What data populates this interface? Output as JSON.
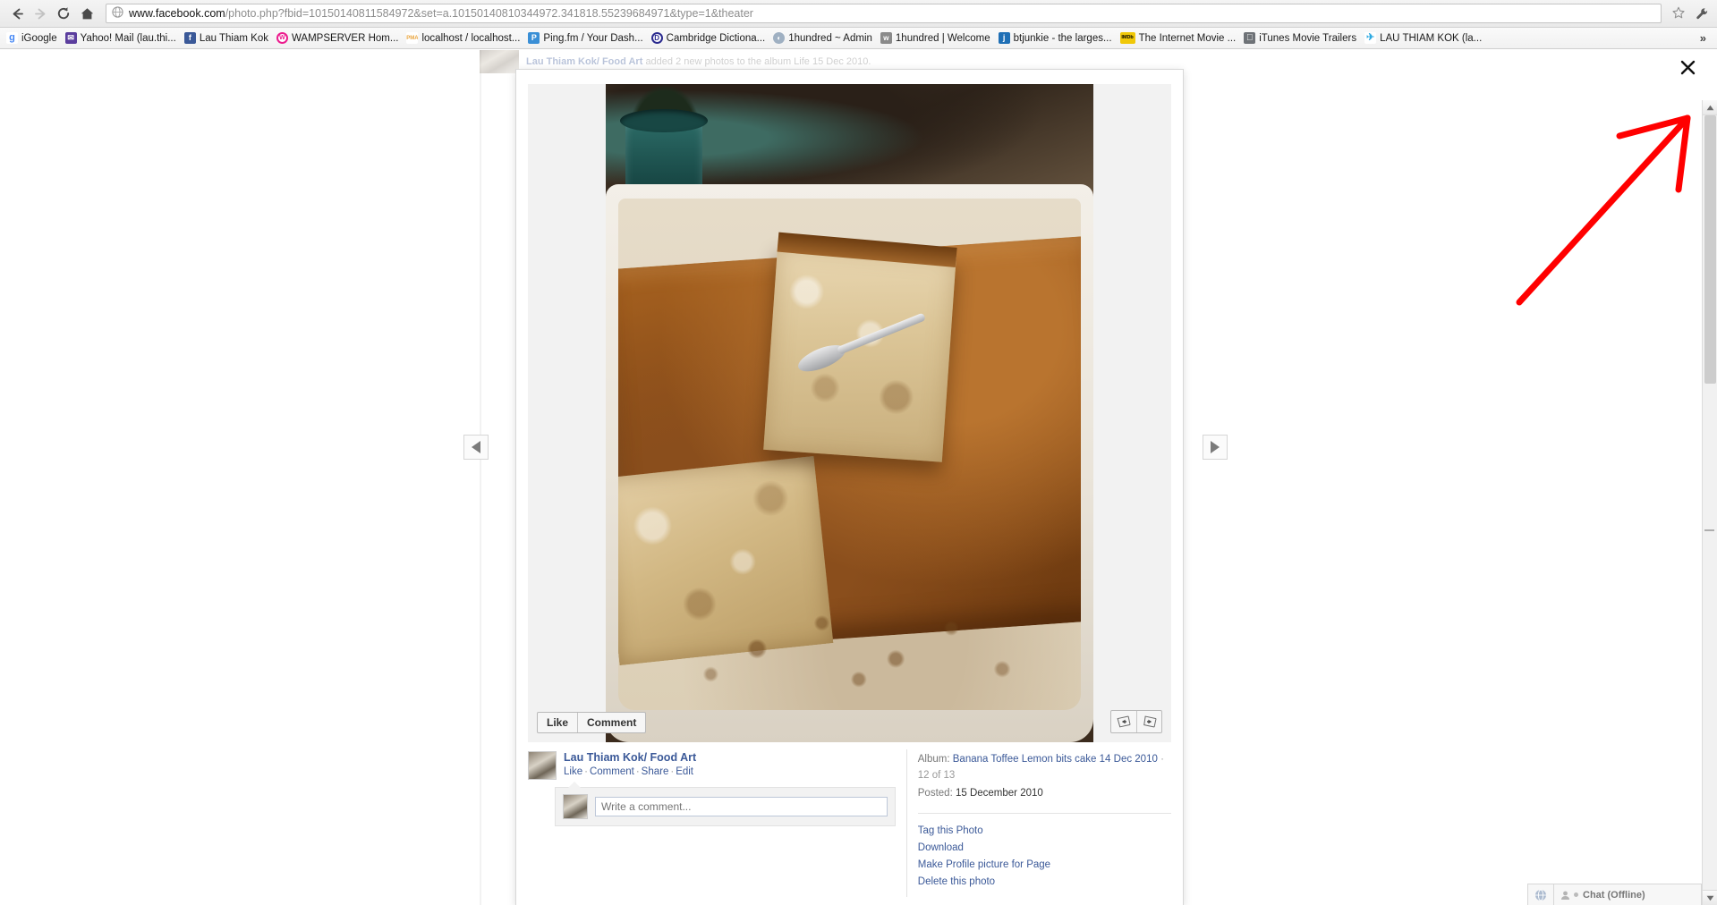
{
  "browser": {
    "back_icon": "back-arrow-icon",
    "forward_icon": "forward-arrow-icon",
    "reload_icon": "reload-icon",
    "home_icon": "home-icon",
    "url_host": "www.facebook.com",
    "url_path": "/photo.php?fbid=10150140811584972&set=a.10150140810344972.341818.55239684971&type=1&theater",
    "url_full": "www.facebook.com/photo.php?fbid=10150140811584972&set=a.10150140810344972.341818.55239684971&type=1&theater",
    "star_icon": "bookmark-star-icon",
    "wrench_icon": "wrench-menu-icon",
    "overflow_label": "»"
  },
  "bookmarks": [
    {
      "label": "iGoogle",
      "icon": "igoogle-favicon",
      "letter": "g",
      "bg": "#4285f4"
    },
    {
      "label": "Yahoo! Mail (lau.thi...",
      "icon": "yahoo-mail-favicon",
      "letter": "✉",
      "bg": "#5b3e9e"
    },
    {
      "label": "Lau Thiam Kok",
      "icon": "facebook-favicon",
      "letter": "f",
      "bg": "#3b5998"
    },
    {
      "label": "WAMPSERVER Hom...",
      "icon": "wampserver-favicon",
      "letter": "W",
      "bg": "#ec1c8e"
    },
    {
      "label": "localhost / localhost...",
      "icon": "phpmyadmin-favicon",
      "letter": "P",
      "bg": "#e8a33d"
    },
    {
      "label": "Ping.fm / Your Dash...",
      "icon": "pingfm-favicon",
      "letter": "P",
      "bg": "#3a8fd6"
    },
    {
      "label": "Cambridge Dictiona...",
      "icon": "cambridge-favicon",
      "letter": "D",
      "bg": "#2b2b8f"
    },
    {
      "label": "1hundred ~ Admin",
      "icon": "globe-favicon",
      "letter": "◐",
      "bg": "#8d9aa8"
    },
    {
      "label": "1hundred | Welcome",
      "icon": "wordpress-favicon",
      "letter": "w",
      "bg": "#6f6f6f"
    },
    {
      "label": "btjunkie - the larges...",
      "icon": "btjunkie-favicon",
      "letter": "j",
      "bg": "#1f6fb5"
    },
    {
      "label": "The Internet Movie ...",
      "icon": "imdb-favicon",
      "letter": "IMDb",
      "bg": "#e6b800"
    },
    {
      "label": "iTunes Movie Trailers",
      "icon": "apple-favicon",
      "letter": "",
      "bg": "#6e7277"
    },
    {
      "label": "LAU THIAM KOK (la...",
      "icon": "twitter-favicon",
      "letter": "t",
      "bg": "#2ca9e1"
    }
  ],
  "background_feed": {
    "actor": "Lau Thiam Kok/ Food Art",
    "text": "added 2 new photos to the album Life 15 Dec 2010."
  },
  "theater": {
    "close_icon": "close-x-icon",
    "prev_icon": "prev-arrow-icon",
    "next_icon": "next-arrow-icon",
    "photo_alt": "Banana toffee lemon bits cake in a white baking dish with a slice cut and a spoon",
    "photo_actions": [
      {
        "label": "Like",
        "name": "like-button"
      },
      {
        "label": "Comment",
        "name": "comment-button"
      }
    ],
    "rotate_left_icon": "rotate-left-icon",
    "rotate_right_icon": "rotate-right-icon",
    "poster": {
      "name": "Lau Thiam Kok/ Food Art",
      "avatar": "poster-avatar",
      "links": [
        "Like",
        "Comment",
        "Share",
        "Edit"
      ]
    },
    "comment": {
      "avatar": "commenter-avatar",
      "placeholder": "Write a comment..."
    },
    "meta": {
      "album_label": "Album:",
      "album_name": "Banana Toffee Lemon bits cake 14 Dec 2010",
      "album_position": "12 of 13",
      "posted_label": "Posted:",
      "posted_date": "15 December 2010"
    },
    "actions": [
      {
        "label": "Tag this Photo",
        "name": "tag-this-photo-link"
      },
      {
        "label": "Download",
        "name": "download-link"
      },
      {
        "label": "Make Profile picture for Page",
        "name": "make-profile-picture-link"
      },
      {
        "label": "Delete this photo",
        "name": "delete-this-photo-link"
      }
    ]
  },
  "chat": {
    "globe_icon": "globe-icon",
    "label": "Chat (Offline)"
  },
  "annotation": {
    "arrow_color": "#ff0000",
    "points_to": "close-x-icon"
  },
  "colors": {
    "facebook_blue": "#3b5998",
    "chrome_toolbar": "#f1f1f1",
    "annotation_red": "#ff0000"
  }
}
